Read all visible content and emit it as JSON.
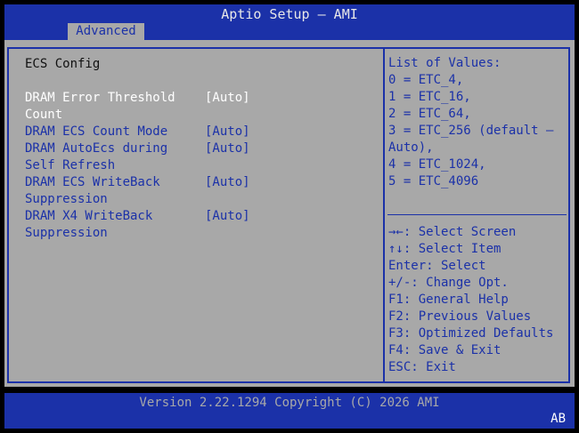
{
  "window": {
    "title": "Aptio Setup – AMI"
  },
  "tabs": [
    {
      "label": "Advanced"
    }
  ],
  "section": {
    "title": "ECS Config"
  },
  "settings": [
    {
      "label": "DRAM Error Threshold\nCount",
      "value": "[Auto]"
    },
    {
      "label": "DRAM ECS Count Mode",
      "value": "[Auto]"
    },
    {
      "label": "DRAM AutoEcs during\nSelf Refresh",
      "value": "[Auto]"
    },
    {
      "label": "DRAM ECS WriteBack\nSuppression",
      "value": "[Auto]"
    },
    {
      "label": "DRAM X4 WriteBack\nSuppression",
      "value": "[Auto]"
    }
  ],
  "help": {
    "lines": [
      "List of Values:",
      "0 = ETC_4,",
      "1 = ETC_16,",
      "2 = ETC_64,",
      "3 = ETC_256 (default –",
      "Auto),",
      "4 = ETC_1024,",
      "5 = ETC_4096"
    ]
  },
  "keys": [
    "→←: Select Screen",
    "↑↓: Select Item",
    "Enter: Select",
    "+/-: Change Opt.",
    "F1: General Help",
    "F2: Previous Values",
    "F3: Optimized Defaults",
    "F4: Save & Exit",
    "ESC: Exit"
  ],
  "footer": {
    "version": "Version 2.22.1294 Copyright (C) 2026 AMI",
    "badge": "AB"
  },
  "colors": {
    "blue": "#1b31a8",
    "gray": "#a8a8a8",
    "selected": "#ffffff"
  }
}
